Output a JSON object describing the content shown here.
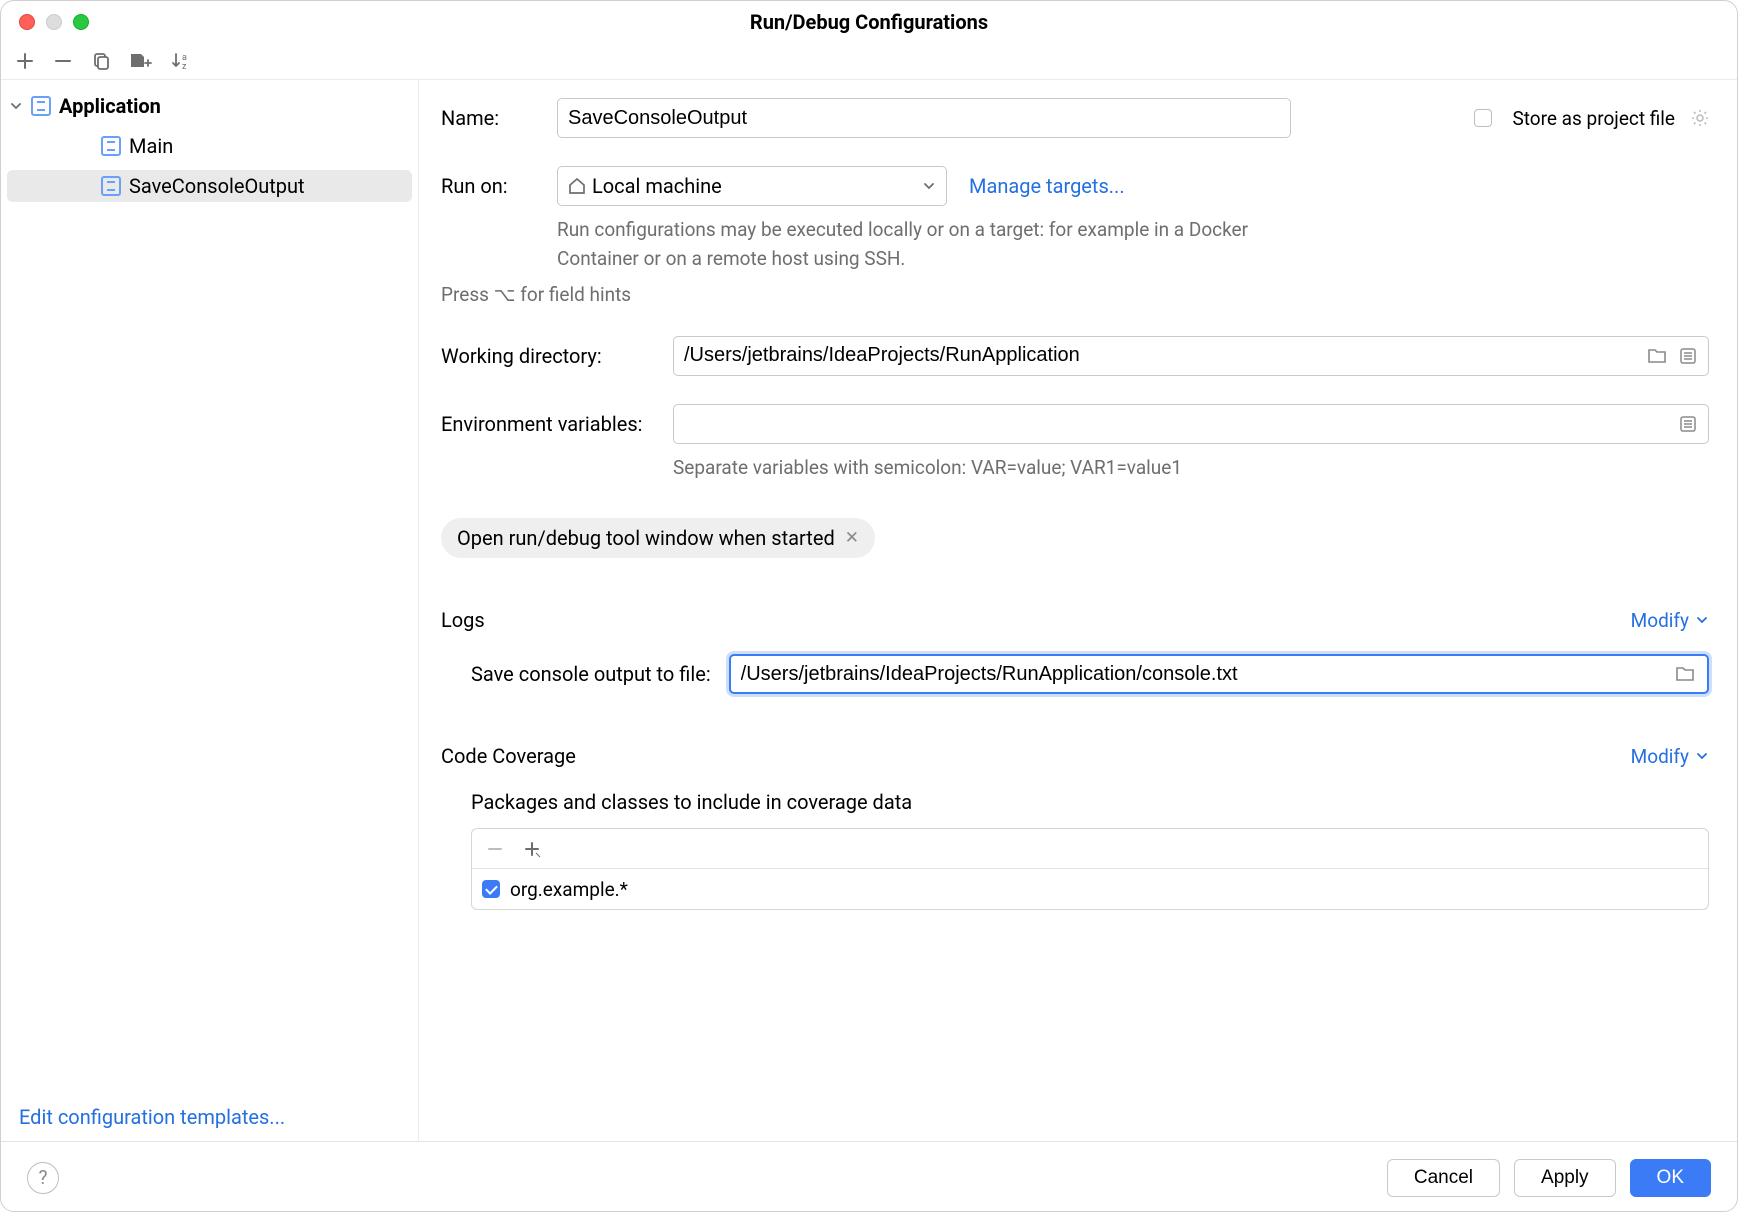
{
  "window": {
    "title": "Run/Debug Configurations"
  },
  "sidebar": {
    "root": "Application",
    "items": [
      "Main",
      "SaveConsoleOutput"
    ],
    "selected": "SaveConsoleOutput",
    "edit_templates": "Edit configuration templates..."
  },
  "form": {
    "name_label": "Name:",
    "name_value": "SaveConsoleOutput",
    "store": "Store as project file",
    "run_on_label": "Run on:",
    "run_on_value": "Local machine",
    "manage_targets": "Manage targets...",
    "run_on_help": "Run configurations may be executed locally or on a target: for example in a Docker Container or on a remote host using SSH.",
    "field_hints": "Press ⌥ for field hints",
    "wd_label": "Working directory:",
    "wd_value": "/Users/jetbrains/IdeaProjects/RunApplication",
    "env_label": "Environment variables:",
    "env_value": "",
    "env_help": "Separate variables with semicolon: VAR=value; VAR1=value1",
    "chip": "Open run/debug tool window when started"
  },
  "sections": {
    "logs_title": "Logs",
    "modify": "Modify",
    "logs_field_label": "Save console output to file:",
    "logs_field_value": "/Users/jetbrains/IdeaProjects/RunApplication/console.txt",
    "coverage_title": "Code Coverage",
    "coverage_sub": "Packages and classes to include in coverage data",
    "coverage_item": "org.example.*"
  },
  "footer": {
    "cancel": "Cancel",
    "apply": "Apply",
    "ok": "OK"
  }
}
